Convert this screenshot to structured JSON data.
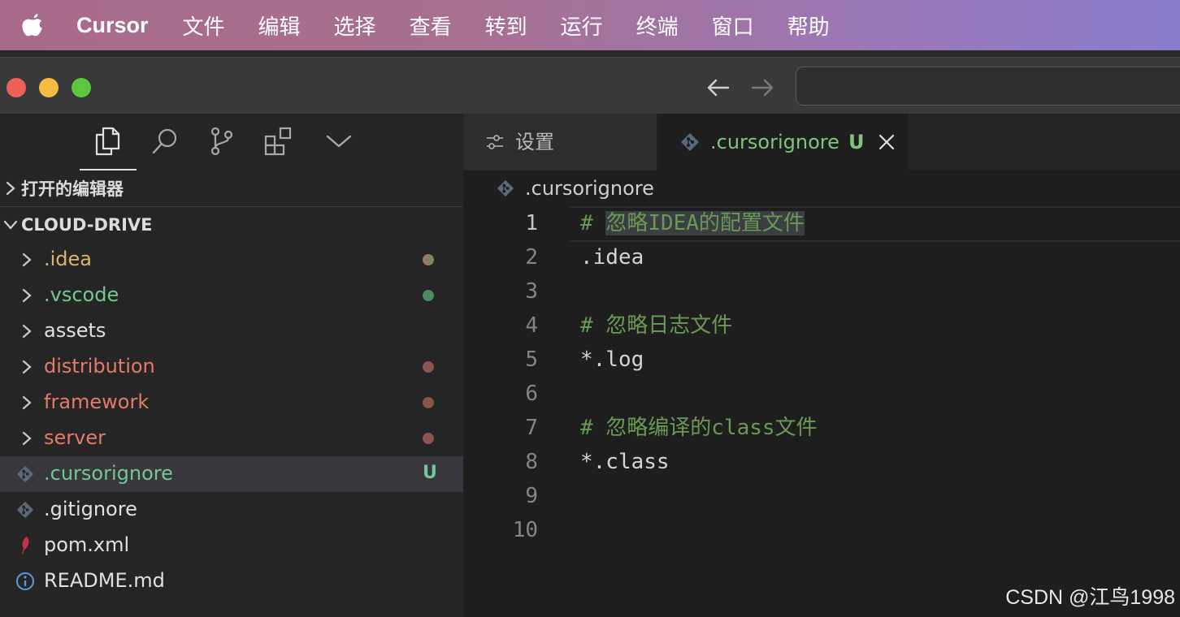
{
  "menubar": {
    "app_name": "Cursor",
    "items": [
      "文件",
      "编辑",
      "选择",
      "查看",
      "转到",
      "运行",
      "终端",
      "窗口",
      "帮助"
    ]
  },
  "sidebar": {
    "sections": {
      "open_editors": "打开的编辑器",
      "project": "CLOUD-DRIVE"
    },
    "tree": [
      {
        "label": ".idea",
        "type": "folder",
        "color": "#d9b56b",
        "status": "dot",
        "status_color": "#8a7f66"
      },
      {
        "label": ".vscode",
        "type": "folder",
        "color": "#73c991",
        "status": "dot",
        "status_color": "#4d8a5e"
      },
      {
        "label": "assets",
        "type": "folder",
        "color": "#e0e0e0",
        "status": "none"
      },
      {
        "label": "distribution",
        "type": "folder",
        "color": "#e57a6a",
        "status": "dot",
        "status_color": "#8a5550"
      },
      {
        "label": "framework",
        "type": "folder",
        "color": "#e57a6a",
        "status": "dot",
        "status_color": "#8a5550"
      },
      {
        "label": "server",
        "type": "folder",
        "color": "#e57a6a",
        "status": "dot",
        "status_color": "#8a5550"
      },
      {
        "label": ".cursorignore",
        "type": "git-file",
        "color": "#73c991",
        "status": "badge",
        "badge": "U",
        "status_color": "#73c991"
      },
      {
        "label": ".gitignore",
        "type": "git-file",
        "color": "#e0e0e0",
        "status": "none"
      },
      {
        "label": "pom.xml",
        "type": "maven-file",
        "color": "#e0e0e0",
        "status": "none"
      },
      {
        "label": "README.md",
        "type": "info-file",
        "color": "#e0e0e0",
        "status": "none"
      }
    ]
  },
  "tabs": {
    "settings": "设置",
    "active": ".cursorignore",
    "active_badge": "U"
  },
  "breadcrumb": ".cursorignore",
  "editor": {
    "lines": [
      {
        "num": "1",
        "text": "# 忽略IDEA的配置文件",
        "kind": "comment"
      },
      {
        "num": "2",
        "text": ".idea",
        "kind": "plain"
      },
      {
        "num": "3",
        "text": "",
        "kind": "plain"
      },
      {
        "num": "4",
        "text": "# 忽略日志文件",
        "kind": "comment"
      },
      {
        "num": "5",
        "text": "*.log",
        "kind": "plain"
      },
      {
        "num": "6",
        "text": "",
        "kind": "plain"
      },
      {
        "num": "7",
        "text": "# 忽略编译的class文件",
        "kind": "comment"
      },
      {
        "num": "8",
        "text": "*.class",
        "kind": "plain"
      },
      {
        "num": "9",
        "text": "",
        "kind": "plain"
      },
      {
        "num": "10",
        "text": "",
        "kind": "plain"
      }
    ]
  },
  "watermark": "CSDN @江鸟1998"
}
